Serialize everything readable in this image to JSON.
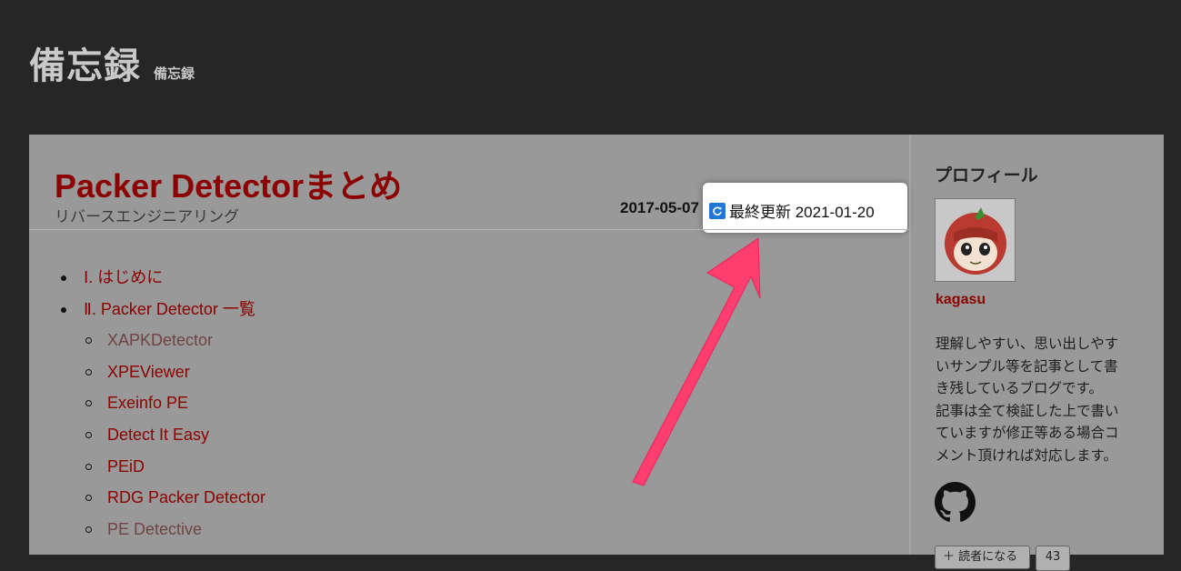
{
  "blog": {
    "title": "備忘録",
    "subtitle": "備忘録"
  },
  "article": {
    "title": "Packer Detectorまとめ",
    "category": "リバースエンジニアリング",
    "date_posted": "2017-05-07",
    "updated_label": "最終更新 2021-01-20",
    "update_icon": "refresh-icon"
  },
  "toc": [
    {
      "level": 1,
      "label": "Ⅰ. はじめに"
    },
    {
      "level": 1,
      "label": "Ⅱ. Packer Detector 一覧"
    },
    {
      "level": 2,
      "label": "XAPKDetector"
    },
    {
      "level": 2,
      "label": "XPEViewer"
    },
    {
      "level": 2,
      "label": "Exeinfo PE"
    },
    {
      "level": 2,
      "label": "Detect It Easy"
    },
    {
      "level": 2,
      "label": "PEiD"
    },
    {
      "level": 2,
      "label": "RDG Packer Detector"
    },
    {
      "level": 2,
      "label": "PE Detective"
    }
  ],
  "sidebar": {
    "heading": "プロフィール",
    "username": "kagasu",
    "bio": [
      "理解しやすい、思い出しやす",
      "いサンプル等を記事として書",
      "き残しているブログです。",
      "記事は全て検証した上で書い",
      "ていますが修正等ある場合コ",
      "メント頂ければ対応します。"
    ],
    "github_icon": "github-icon",
    "reader_button": "読者になる",
    "reader_count": "43"
  },
  "colors": {
    "page_bg": "#262626",
    "panel_bg": "#999999",
    "link": "#8c0000",
    "annotation_arrow": "#ff3d6e"
  }
}
